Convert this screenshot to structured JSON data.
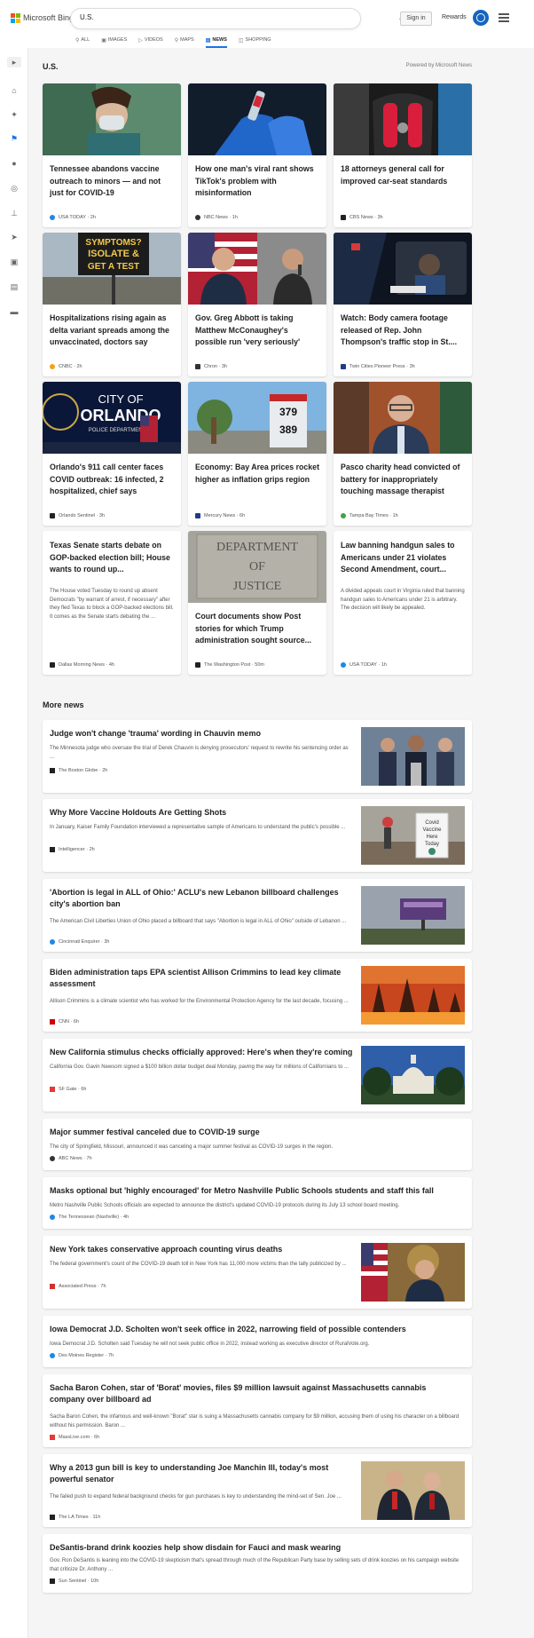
{
  "header": {
    "brand": "Microsoft Bing",
    "query": "U.S.",
    "signin": "Sign in",
    "rewards": "Rewards"
  },
  "tabs": [
    {
      "label": "ALL",
      "icon": "search-icon"
    },
    {
      "label": "IMAGES",
      "icon": "image-icon"
    },
    {
      "label": "VIDEOS",
      "icon": "video-icon"
    },
    {
      "label": "MAPS",
      "icon": "map-pin-icon"
    },
    {
      "label": "NEWS",
      "icon": "news-icon",
      "active": true
    },
    {
      "label": "SHOPPING",
      "icon": "shopping-bag-icon"
    }
  ],
  "section": {
    "title": "U.S.",
    "powered": "Powered by Microsoft News"
  },
  "cards": [
    {
      "title": "Tennessee abandons vaccine outreach to minors — and not just for COVID-19",
      "source": "USA TODAY",
      "time": "2h",
      "source_color": "#1e88e5"
    },
    {
      "title": "How one man's viral rant shows TikTok's problem with misinformation",
      "source": "NBC News",
      "time": "1h",
      "source_color": "#333333"
    },
    {
      "title": "18 attorneys general call for improved car-seat standards",
      "source": "CBS News",
      "time": "3h",
      "source_color": "#222222"
    },
    {
      "title": "Hospitalizations rising again as delta variant spreads among the unvaccinated, doctors say",
      "source": "CNBC",
      "time": "2h",
      "source_color": "#f4a21b"
    },
    {
      "title": "Gov. Greg Abbott is taking Matthew McConaughey's possible run 'very seriously'",
      "source": "Chron",
      "time": "3h",
      "source_color": "#333333"
    },
    {
      "title": "Watch: Body camera footage released of Rep. John Thompson's traffic stop in St....",
      "source": "Twin Cities Pioneer Press",
      "time": "3h",
      "source_color": "#1f3c88"
    },
    {
      "title": "Orlando's 911 call center faces COVID outbreak: 16 infected, 2 hospitalized, chief says",
      "source": "Orlando Sentinel",
      "time": "3h",
      "source_color": "#222222"
    },
    {
      "title": "Economy: Bay Area prices rocket higher as inflation grips region",
      "source": "Mercury News",
      "time": "6h",
      "source_color": "#1f3c88"
    },
    {
      "title": "Pasco charity head convicted of battery for inappropriately touching massage therapist",
      "source": "Tampa Bay Times",
      "time": "1h",
      "source_color": "#43a047"
    },
    {
      "title": "Texas Senate starts debate on GOP-backed election bill; House wants to round up...",
      "snippet": "The House voted Tuesday to round up absent Democrats \"by warrant of arrest, if necessary\" after they fled Texas to block a GOP-backed elections bill. It comes as the Senate starts debating the ...",
      "source": "Dallas Morning News",
      "time": "4h",
      "source_color": "#222222"
    },
    {
      "title": "Court documents show Post stories for which Trump administration sought source...",
      "source": "The Washington Post",
      "time": "50m",
      "source_color": "#222222",
      "image_text": "DEPARTMENT OF JUSTICE"
    },
    {
      "title": "Law banning handgun sales to Americans under 21 violates Second Amendment, court...",
      "snippet": "A divided appeals court in Virginia ruled that banning handgun sales to Americans under 21 is arbitrary. The decision will likely be appealed.",
      "source": "USA TODAY",
      "time": "1h",
      "source_color": "#1e88e5"
    }
  ],
  "city_sign": {
    "line1": "CITY OF",
    "line2": "ORLANDO",
    "line3": "POLICE DEPARTMENT"
  },
  "gas_prices": {
    "p1": "379",
    "p2": "389"
  },
  "vaccine_sign": {
    "line1": "Covid",
    "line2": "Vaccine",
    "line3": "Here",
    "line4": "Today"
  },
  "covid_sign": {
    "line1": "SYMPTOMS?",
    "line2": "ISOLATE &",
    "line3": "GET A TEST"
  },
  "more_news": {
    "title": "More news",
    "items": [
      {
        "title": "Judge won't change 'trauma' wording in Chauvin memo",
        "snippet": "The Minnesota judge who oversaw the trial of Derek Chauvin is denying prosecutors' request to rewrite his sentencing order as ...",
        "source": "The Boston Globe",
        "time": "2h",
        "source_color": "#222222"
      },
      {
        "title": "Why More Vaccine Holdouts Are Getting Shots",
        "snippet": "In January, Kaiser Family Foundation interviewed a representative sample of Americans to understand the public's possible ...",
        "source": "Intelligencer",
        "time": "2h",
        "source_color": "#222222"
      },
      {
        "title": "'Abortion is legal in ALL of Ohio:' ACLU's new Lebanon billboard challenges city's abortion ban",
        "snippet": "The American Civil Liberties Union of Ohio placed a billboard that says \"Abortion is legal in ALL of Ohio\" outside of Lebanon ...",
        "source": "Cincinnati Enquirer",
        "time": "3h",
        "source_color": "#1e88e5"
      },
      {
        "title": "Biden administration taps EPA scientist Allison Crimmins to lead key climate assessment",
        "snippet": "Allison Crimmins is a climate scientist who has worked for the Environmental Protection Agency for the last decade, focusing ...",
        "source": "CNN",
        "time": "6h",
        "source_color": "#cc0000"
      },
      {
        "title": "New California stimulus checks officially approved: Here's when they're coming",
        "snippet": "California Gov. Gavin Newsom signed a $100 billion dollar budget deal Monday, paving the way for millions of Californians to ...",
        "source": "SF Gate",
        "time": "6h",
        "source_color": "#e53935"
      },
      {
        "title": "Major summer festival canceled due to COVID-19 surge",
        "snippet": "The city of Springfield, Missouri, announced it was canceling a major summer festival as COVID-19 surges in the region.",
        "source": "ABC News",
        "time": "7h",
        "source_color": "#333333"
      },
      {
        "title": "Masks optional but 'highly encouraged' for Metro Nashville Public Schools students and staff this fall",
        "snippet": "Metro Nashville Public Schools officials are expected to announce the district's updated COVID-19 protocols during its July 13 school board meeting.",
        "source": "The Tennessean (Nashville)",
        "time": "4h",
        "source_color": "#1e88e5"
      },
      {
        "title": "New York takes conservative approach counting virus deaths",
        "snippet": "The federal government's count of the COVID-19 death toll in New York has 11,000 more victims than the tally publicized by ...",
        "source": "Associated Press",
        "time": "7h",
        "source_color": "#d32f2f"
      },
      {
        "title": "Iowa Democrat J.D. Scholten won't seek office in 2022, narrowing field of possible contenders",
        "snippet": "Iowa Democrat J.D. Scholten said Tuesday he will not seek public office in 2022, instead working as executive director of RuralVote.org.",
        "source": "Des Moines Register",
        "time": "7h",
        "source_color": "#1e88e5"
      },
      {
        "title": "Sacha Baron Cohen, star of 'Borat' movies, files $9 million lawsuit against Massachusetts cannabis company over billboard ad",
        "snippet": "Sacha Baron Cohen, the infamous and well-known \"Borat\" star is suing a Massachusetts cannabis company for $9 million, accusing them of using his character on a billboard without his permission. Baron ...",
        "source": "MassLive.com",
        "time": "6h",
        "source_color": "#e53935"
      },
      {
        "title": "Why a 2013 gun bill is key to understanding Joe Manchin III, today's most powerful senator",
        "snippet": "The failed push to expand federal background checks for gun purchases is key to understanding the mind-set of Sen. Joe ...",
        "source": "The LA Times",
        "time": "11h",
        "source_color": "#222222"
      },
      {
        "title": "DeSantis-brand drink koozies help show disdain for Fauci and mask wearing",
        "snippet": "Gov. Ron DeSantis is leaning into the COVID-19 skepticism that's spread through much of the Republican Party base by selling sets of drink koozies on his campaign website that criticize Dr. Anthony ...",
        "source": "Sun Sentinel",
        "time": "10h",
        "source_color": "#222222"
      }
    ]
  }
}
